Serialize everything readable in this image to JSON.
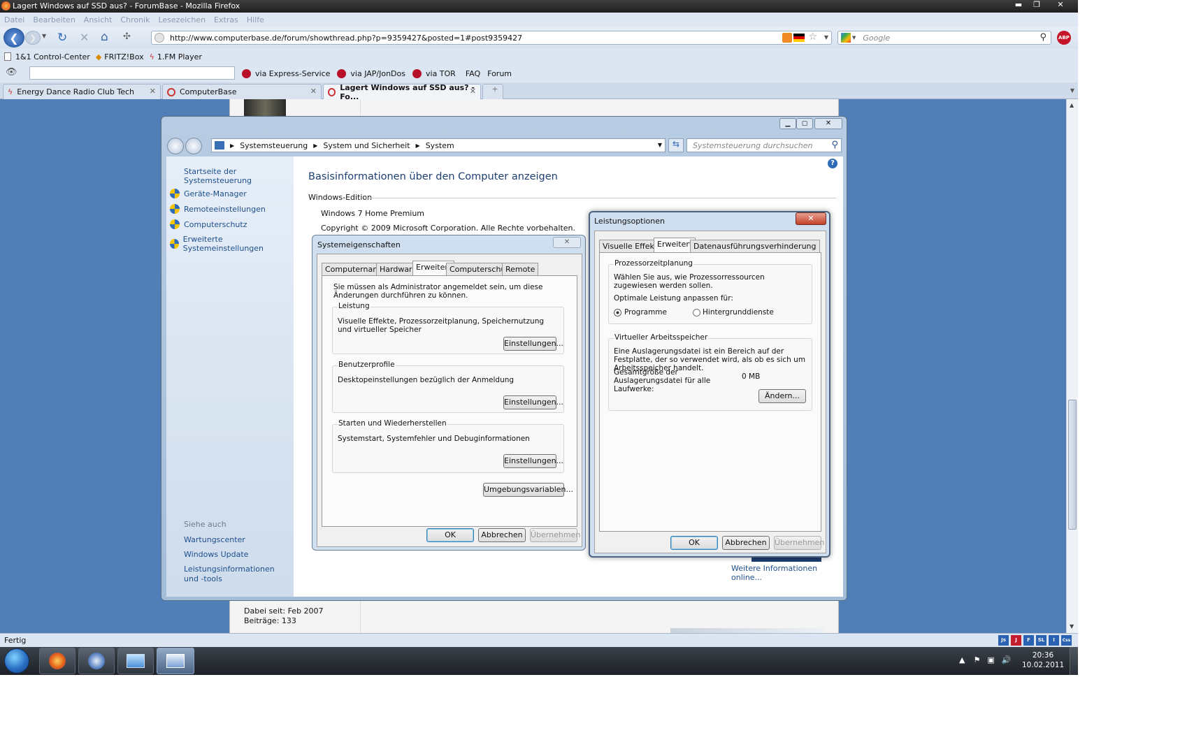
{
  "browser": {
    "title": "Lagert Windows auf SSD aus? - ForumBase - Mozilla Firefox",
    "menu": [
      "Datei",
      "Bearbeiten",
      "Ansicht",
      "Chronik",
      "Lesezeichen",
      "Extras",
      "Hilfe"
    ],
    "url": "http://www.computerbase.de/forum/showthread.php?p=9359427&posted=1#post9359427",
    "search_placeholder": "Google",
    "bookmarks": [
      "1&1 Control-Center",
      "FRITZ!Box",
      "1.FM Player"
    ],
    "toolbar2": [
      "via Express-Service",
      "via JAP/JonDos",
      "via TOR",
      "FAQ",
      "Forum"
    ],
    "tabs": [
      {
        "label": "Energy Dance Radio Club Tech"
      },
      {
        "label": "ComputerBase"
      },
      {
        "label": "Lagert Windows auf SSD aus? - Fo..."
      }
    ],
    "status": "Fertig",
    "status_icons": [
      "Js",
      "J",
      "F",
      "SL",
      "I",
      "Css"
    ]
  },
  "forum": {
    "member_since": "Dabei seit: Feb 2007",
    "posts": "Beiträge: 133",
    "ghost_text": "Dabei seit: Feb 2007"
  },
  "control_panel": {
    "breadcrumb": [
      "Systemsteuerung",
      "System und Sicherheit",
      "System"
    ],
    "search_placeholder": "Systemsteuerung durchsuchen",
    "left_home": "Startseite der Systemsteuerung",
    "left_links": [
      "Geräte-Manager",
      "Remoteeinstellungen",
      "Computerschutz",
      "Erweiterte Systemeinstellungen"
    ],
    "see_also_title": "Siehe auch",
    "see_also": [
      "Wartungscenter",
      "Windows Update",
      "Leistungsinformationen und -tools"
    ],
    "heading": "Basisinformationen über den Computer anzeigen",
    "edition_title": "Windows-Edition",
    "edition": "Windows 7 Home Premium",
    "copyright": "Copyright © 2009 Microsoft Corporation. Alle Rechte vorbehalten.",
    "more_info": "Weitere Informationen online..."
  },
  "sysprops": {
    "title": "Systemeigenschaften",
    "tabs": [
      "Computername",
      "Hardware",
      "Erweitert",
      "Computerschutz",
      "Remote"
    ],
    "admin_note": "Sie müssen als Administrator angemeldet sein, um diese Änderungen durchführen zu können.",
    "groups": [
      {
        "title": "Leistung",
        "text": "Visuelle Effekte, Prozessorzeitplanung, Speichernutzung und virtueller Speicher",
        "button": "Einstellungen..."
      },
      {
        "title": "Benutzerprofile",
        "text": "Desktopeinstellungen bezüglich der Anmeldung",
        "button": "Einstellungen..."
      },
      {
        "title": "Starten und Wiederherstellen",
        "text": "Systemstart, Systemfehler und Debuginformationen",
        "button": "Einstellungen..."
      }
    ],
    "env_button": "Umgebungsvariablen...",
    "ok": "OK",
    "cancel": "Abbrechen",
    "apply": "Übernehmen"
  },
  "perfopts": {
    "title": "Leistungsoptionen",
    "tabs": [
      "Visuelle Effekte",
      "Erweitert",
      "Datenausführungsverhinderung"
    ],
    "sched_title": "Prozessorzeitplanung",
    "sched_text": "Wählen Sie aus, wie Prozessorressourcen zugewiesen werden sollen.",
    "sched_opt_label": "Optimale Leistung anpassen für:",
    "radio_programs": "Programme",
    "radio_services": "Hintergrunddienste",
    "vm_title": "Virtueller Arbeitsspeicher",
    "vm_text": "Eine Auslagerungsdatei ist ein Bereich auf der Festplatte, der so verwendet wird, als ob es sich um Arbeitsspeicher handelt.",
    "vm_total_label": "Gesamtgröße der Auslagerungsdatei für alle Laufwerke:",
    "vm_total_value": "0 MB",
    "change_button": "Ändern...",
    "ok": "OK",
    "cancel": "Abbrechen",
    "apply": "Übernehmen"
  },
  "taskbar": {
    "time": "20:36",
    "date": "10.02.2011"
  }
}
